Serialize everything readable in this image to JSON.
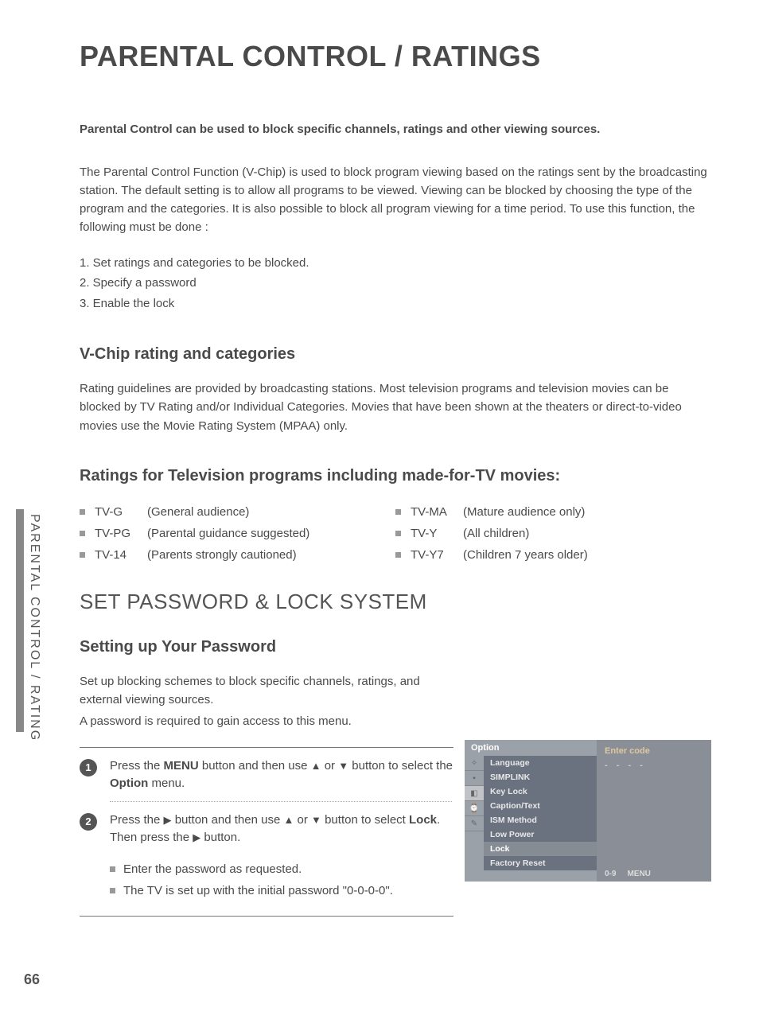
{
  "page_number": "66",
  "side_tab": "PARENTAL CONTROL / RATING",
  "title": "PARENTAL CONTROL / RATINGS",
  "intro_bold": "Parental Control can be used to block specific channels, ratings and other viewing sources.",
  "intro_para": "The Parental Control Function (V-Chip) is used to block program viewing based on the ratings sent by the broadcasting station. The default setting is to allow all programs to be viewed. Viewing can be blocked by choosing the type of the program and the categories. It is also possible to block all program viewing for a time period. To use this function, the following must be done :",
  "steps": {
    "s1": "1. Set ratings and categories to be blocked.",
    "s2": "2. Specify a password",
    "s3": "3. Enable the lock"
  },
  "h_vchip": "V-Chip rating and categories",
  "vchip_para": "Rating guidelines are provided by broadcasting stations. Most television programs and television movies can be blocked by TV Rating and/or Individual Categories. Movies that have been shown at the theaters or direct-to-video movies use the Movie Rating System (MPAA) only.",
  "h_ratings": "Ratings for Television programs including made-for-TV movies:",
  "ratings_left": [
    {
      "code": "TV-G",
      "desc": "(General audience)"
    },
    {
      "code": "TV-PG",
      "desc": "(Parental guidance suggested)"
    },
    {
      "code": "TV-14",
      "desc": "(Parents strongly cautioned)"
    }
  ],
  "ratings_right": [
    {
      "code": "TV-MA",
      "desc": "(Mature audience only)"
    },
    {
      "code": "TV-Y",
      "desc": "(All children)"
    },
    {
      "code": "TV-Y7",
      "desc": "(Children 7 years older)"
    }
  ],
  "h_setpwd": "SET PASSWORD & LOCK SYSTEM",
  "h_setting": "Setting up Your Password",
  "pwd_para1": "Set up blocking schemes to block specific channels, ratings, and external viewing sources.",
  "pwd_para2": "A password is required to gain access to this menu.",
  "step1_a": "Press the ",
  "step1_menu": "MENU",
  "step1_b": " button and then use ",
  "step1_c": " or ",
  "step1_d": " button to select the ",
  "step1_option": "Option",
  "step1_e": " menu.",
  "step2_a": "Press the ",
  "step2_b": " button and then use ",
  "step2_c": " or ",
  "step2_d": " button to select ",
  "step2_lock": "Lock",
  "step2_e": ". Then press the ",
  "step2_f": " button.",
  "note1": "Enter the password as requested.",
  "note2": "The TV is set up with the initial password \"0-0-0-0\".",
  "osd": {
    "header": "Option",
    "items": [
      "Language",
      "SIMPLINK",
      "Key Lock",
      "Caption/Text",
      "ISM Method",
      "Low Power",
      "Lock",
      "Factory Reset"
    ],
    "highlight_index": 6,
    "right_label": "Enter code",
    "dashes": "- - - -",
    "foot_left": "0-9",
    "foot_right": "MENU"
  },
  "glyph_up": "▲",
  "glyph_down": "▼",
  "glyph_right": "▶"
}
